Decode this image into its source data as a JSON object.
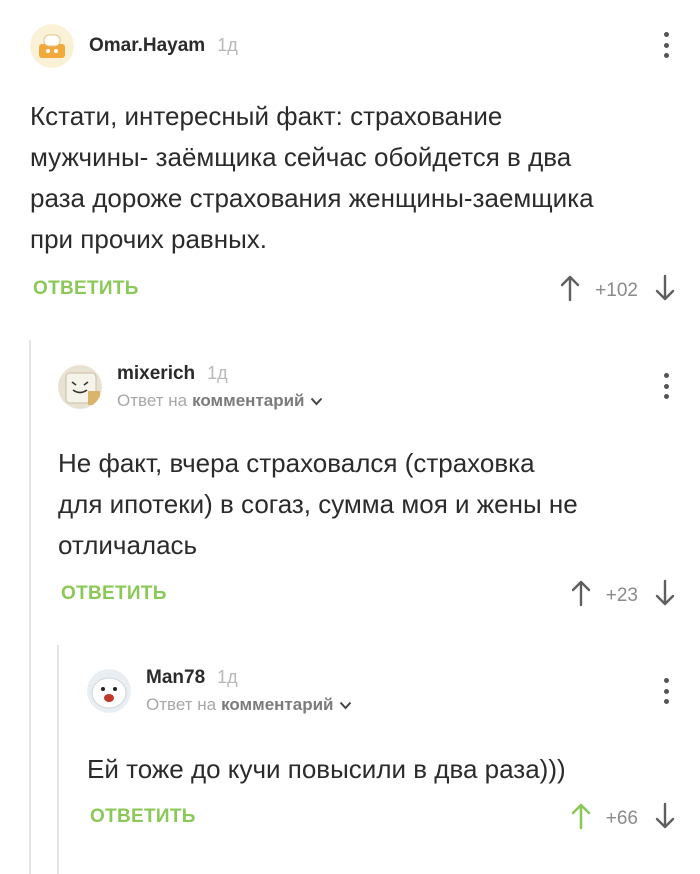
{
  "comments": [
    {
      "username": "Omar.Hayam",
      "time": "1д",
      "text_lines": [
        "Кстати, интересный факт: страхование",
        "мужчины- заёмщика сейчас обойдется в два",
        "раза дороже страхования женщины-заемщика",
        "при прочих равных."
      ],
      "reply_label": "ОТВЕТИТЬ",
      "score": "+102",
      "upvoted": false
    },
    {
      "username": "mixerich",
      "time": "1д",
      "reply_prefix": "Ответ на",
      "reply_target": "комментарий",
      "text_lines": [
        "Не факт, вчера страховался (страховка",
        "для ипотеки) в согаз, сумма моя и жены не",
        "отличалась"
      ],
      "reply_label": "ОТВЕТИТЬ",
      "score": "+23",
      "upvoted": false
    },
    {
      "username": "Man78",
      "time": "1д",
      "reply_prefix": "Ответ на",
      "reply_target": "комментарий",
      "text_lines": [
        "Ей тоже до кучи повысили в два раза)))"
      ],
      "reply_label": "ОТВЕТИТЬ",
      "score": "+66",
      "upvoted": true
    }
  ],
  "colors": {
    "accent_green": "#8ac858",
    "arrow_gray": "#5f5f5f",
    "thread_line": "#e6e6e6"
  },
  "icons": {
    "more": "vertical-ellipsis-icon",
    "upvote": "arrow-up-icon",
    "downvote": "arrow-down-icon",
    "expand": "chevron-down-icon"
  }
}
